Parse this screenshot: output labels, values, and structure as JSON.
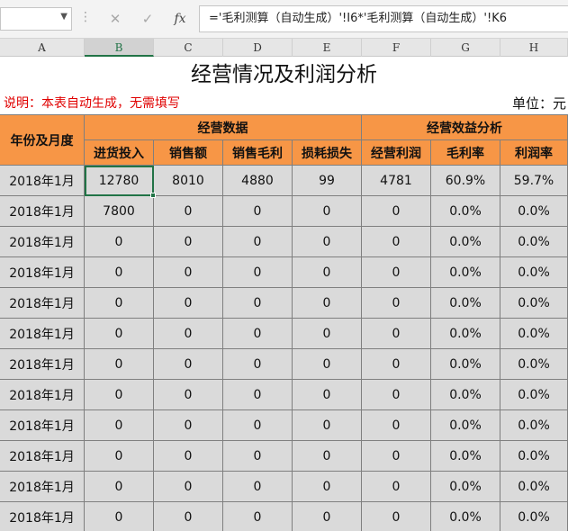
{
  "formula_bar": {
    "cancel_icon": "✕",
    "enter_icon": "✓",
    "fx_label": "fx",
    "formula": "='毛利测算（自动生成）'!I6*'毛利测算（自动生成）'!K6"
  },
  "columns": [
    "A",
    "B",
    "C",
    "D",
    "E",
    "F",
    "G",
    "H"
  ],
  "selected_column": "B",
  "sheet": {
    "title": "经营情况及利润分析",
    "note": "说明：本表自动生成，无需填写",
    "unit": "单位：元",
    "header": {
      "year_month": "年份及月度",
      "group_ops": "经营数据",
      "group_eff": "经营效益分析",
      "subs": [
        "进货投入",
        "销售额",
        "销售毛利",
        "损耗损失",
        "经营利润",
        "毛利率",
        "利润率"
      ]
    },
    "rows": [
      [
        "2018年1月",
        "12780",
        "8010",
        "4880",
        "99",
        "4781",
        "60.9%",
        "59.7%"
      ],
      [
        "2018年1月",
        "7800",
        "0",
        "0",
        "0",
        "0",
        "0.0%",
        "0.0%"
      ],
      [
        "2018年1月",
        "0",
        "0",
        "0",
        "0",
        "0",
        "0.0%",
        "0.0%"
      ],
      [
        "2018年1月",
        "0",
        "0",
        "0",
        "0",
        "0",
        "0.0%",
        "0.0%"
      ],
      [
        "2018年1月",
        "0",
        "0",
        "0",
        "0",
        "0",
        "0.0%",
        "0.0%"
      ],
      [
        "2018年1月",
        "0",
        "0",
        "0",
        "0",
        "0",
        "0.0%",
        "0.0%"
      ],
      [
        "2018年1月",
        "0",
        "0",
        "0",
        "0",
        "0",
        "0.0%",
        "0.0%"
      ],
      [
        "2018年1月",
        "0",
        "0",
        "0",
        "0",
        "0",
        "0.0%",
        "0.0%"
      ],
      [
        "2018年1月",
        "0",
        "0",
        "0",
        "0",
        "0",
        "0.0%",
        "0.0%"
      ],
      [
        "2018年1月",
        "0",
        "0",
        "0",
        "0",
        "0",
        "0.0%",
        "0.0%"
      ],
      [
        "2018年1月",
        "0",
        "0",
        "0",
        "0",
        "0",
        "0.0%",
        "0.0%"
      ],
      [
        "2018年1月",
        "0",
        "0",
        "0",
        "0",
        "0",
        "0.0%",
        "0.0%"
      ]
    ],
    "active_cell": "B6"
  },
  "colors": {
    "header_fill": "#f79646",
    "data_fill": "#dadada",
    "note_text": "#e00000",
    "selection": "#217346"
  }
}
